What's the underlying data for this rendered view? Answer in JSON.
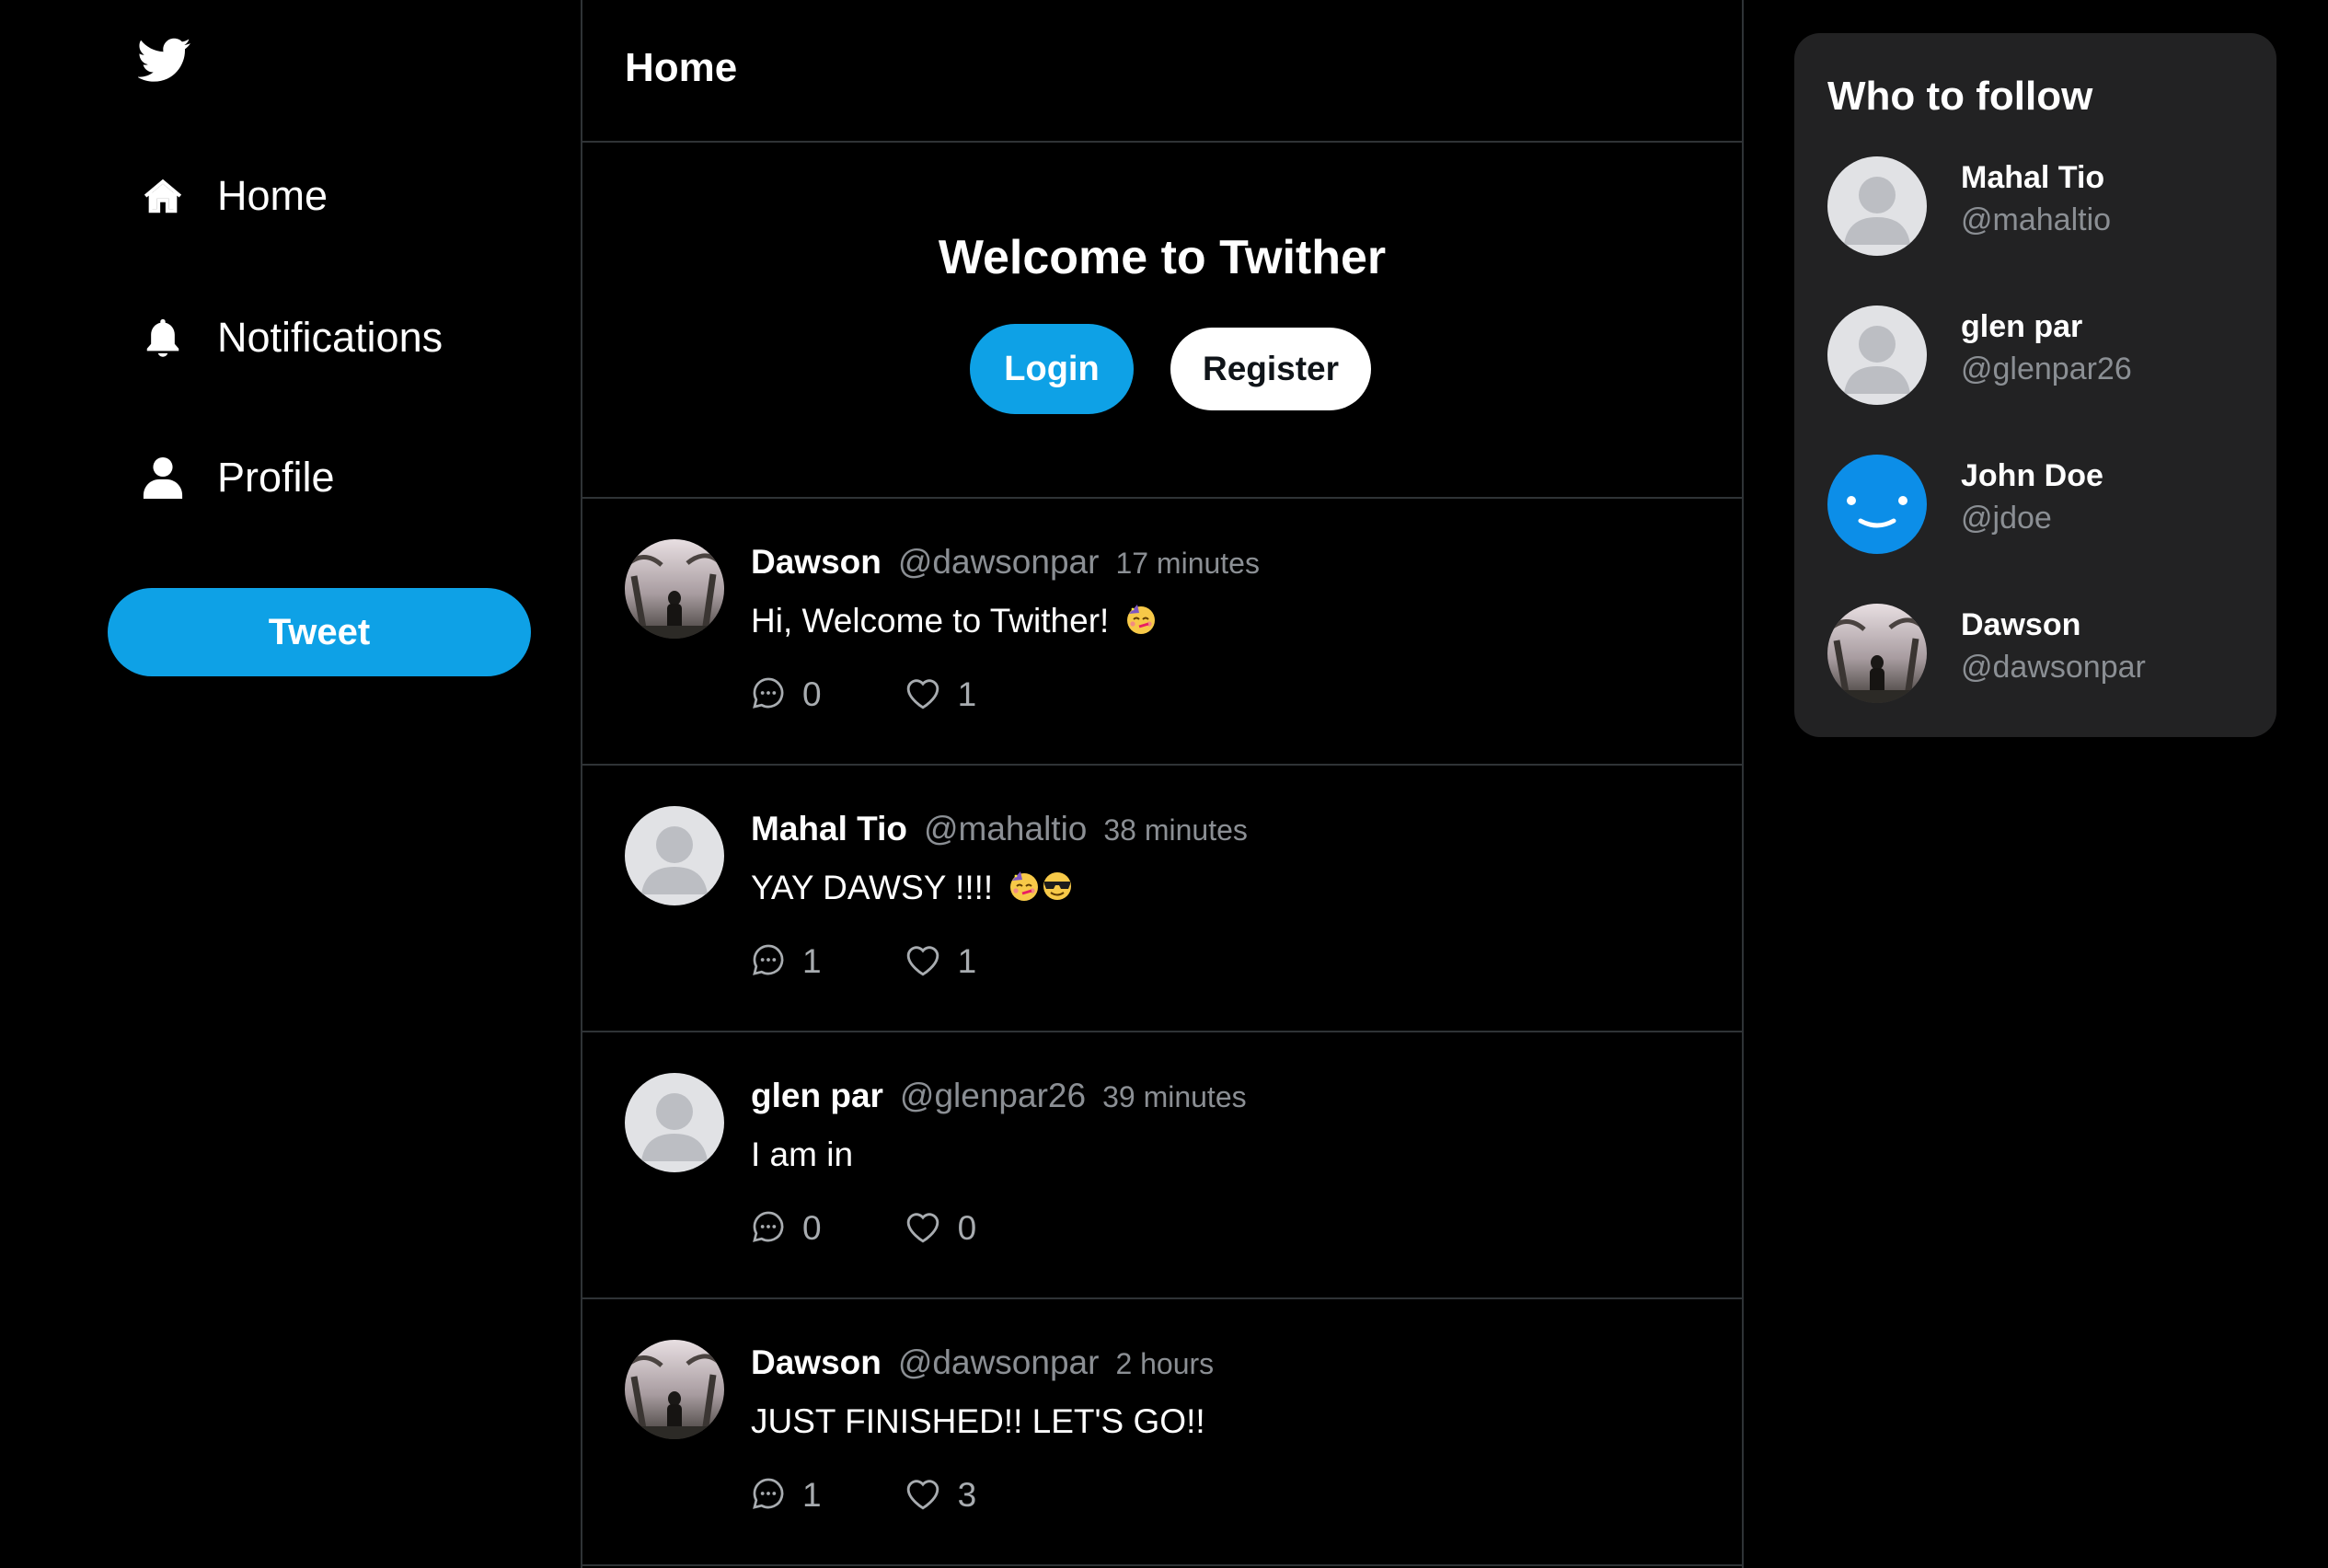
{
  "sidebar": {
    "logo_icon": "bird-icon",
    "nav": [
      {
        "label": "Home",
        "icon": "home-icon"
      },
      {
        "label": "Notifications",
        "icon": "bell-icon"
      },
      {
        "label": "Profile",
        "icon": "user-icon"
      }
    ],
    "tweet_button_label": "Tweet"
  },
  "main": {
    "title": "Home",
    "welcome": {
      "title": "Welcome to Twither",
      "login_label": "Login",
      "register_label": "Register"
    },
    "tweets": [
      {
        "name": "Dawson",
        "handle": "@dawsonpar",
        "time": "17 minutes",
        "text": "Hi, Welcome to Twither!",
        "emojis": [
          "partying-face"
        ],
        "avatar": "photo",
        "comments": "0",
        "likes": "1"
      },
      {
        "name": "Mahal Tio",
        "handle": "@mahaltio",
        "time": "38 minutes",
        "text": "YAY DAWSY !!!!",
        "emojis": [
          "partying-face",
          "sunglasses-face"
        ],
        "avatar": "default",
        "comments": "1",
        "likes": "1"
      },
      {
        "name": "glen par",
        "handle": "@glenpar26",
        "time": "39 minutes",
        "text": "I am in",
        "emojis": [],
        "avatar": "default",
        "comments": "0",
        "likes": "0"
      },
      {
        "name": "Dawson",
        "handle": "@dawsonpar",
        "time": "2 hours",
        "text": "JUST FINISHED!! LET'S GO!!",
        "emojis": [],
        "avatar": "photo",
        "comments": "1",
        "likes": "3"
      }
    ]
  },
  "who_to_follow": {
    "title": "Who to follow",
    "users": [
      {
        "name": "Mahal Tio",
        "handle": "@mahaltio",
        "avatar": "default"
      },
      {
        "name": "glen par",
        "handle": "@glenpar26",
        "avatar": "default"
      },
      {
        "name": "John Doe",
        "handle": "@jdoe",
        "avatar": "smiley"
      },
      {
        "name": "Dawson",
        "handle": "@dawsonpar",
        "avatar": "photo"
      }
    ]
  },
  "colors": {
    "accent": "#0ea1e6",
    "background": "#000000",
    "card": "#222223",
    "muted_text": "#8b8f94",
    "divider": "#2f3336"
  }
}
